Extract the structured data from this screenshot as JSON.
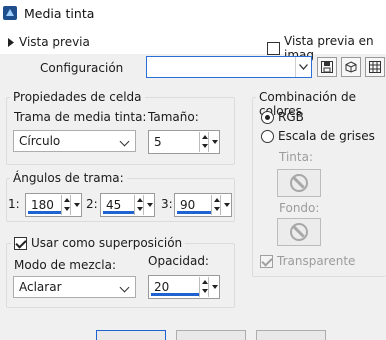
{
  "window": {
    "title": "Media tinta"
  },
  "preview": {
    "expand_label": "Vista previa",
    "checkbox_label": "Vista previa en imag"
  },
  "config": {
    "label": "Configuración",
    "value": ""
  },
  "cell_props": {
    "title": "Propiedades de celda",
    "screen_label": "Trama de media tinta:",
    "screen_value": "Círculo",
    "size_label": "Tamaño:",
    "size_value": "5"
  },
  "angles": {
    "title": "Ángulos de trama:",
    "items": [
      {
        "label": "1:",
        "value": "180"
      },
      {
        "label": "2:",
        "value": "45"
      },
      {
        "label": "3:",
        "value": "90"
      }
    ]
  },
  "overlay": {
    "checkbox_label": "Usar como superposición",
    "checked": true,
    "blend_label": "Modo de mezcla:",
    "blend_value": "Aclarar",
    "opacity_label": "Opacidad:",
    "opacity_value": "20"
  },
  "color_mix": {
    "title": "Combinación de colores",
    "rgb_label": "RGB",
    "gray_label": "Escala de grises",
    "selected": "RGB",
    "ink_label": "Tinta:",
    "bg_label": "Fondo:",
    "transparent_label": "Transparente"
  },
  "colors": {
    "accent": "#1e63d0",
    "dialog_bg": "#f0f0f0"
  }
}
